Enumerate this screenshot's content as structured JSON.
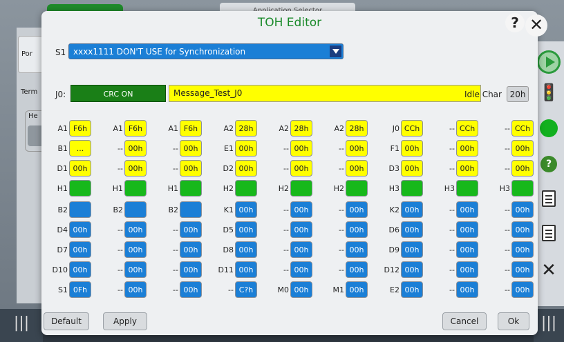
{
  "background": {
    "top_tab": "Application Selector",
    "port_label": "Por",
    "term_label": "Term",
    "he_label": "He"
  },
  "dialog": {
    "title": "TOH Editor",
    "help_glyph": "?",
    "close_glyph": "✕",
    "s1": {
      "label": "S1",
      "value": "xxxx1111 DON'T USE for Synchronization"
    },
    "j0": {
      "label": "J0:",
      "crc_button": "CRC ON",
      "message": "Message_Test_J0"
    },
    "idle": {
      "label": "Idle Char",
      "value": "20h"
    },
    "grid": [
      [
        {
          "l": "A1",
          "v": "F6h",
          "c": "yellow"
        },
        {
          "l": "A1",
          "v": "F6h",
          "c": "yellow"
        },
        {
          "l": "A1",
          "v": "F6h",
          "c": "yellow"
        },
        {
          "l": "A2",
          "v": "28h",
          "c": "yellow"
        },
        {
          "l": "A2",
          "v": "28h",
          "c": "yellow"
        },
        {
          "l": "A2",
          "v": "28h",
          "c": "yellow"
        },
        {
          "l": "J0",
          "v": "CCh",
          "c": "yellow"
        },
        {
          "l": "--",
          "v": "CCh",
          "c": "yellow"
        },
        {
          "l": "--",
          "v": "CCh",
          "c": "yellow"
        }
      ],
      [
        {
          "l": "B1",
          "v": "...",
          "c": "yellow"
        },
        {
          "l": "--",
          "v": "00h",
          "c": "yellow"
        },
        {
          "l": "--",
          "v": "00h",
          "c": "yellow"
        },
        {
          "l": "E1",
          "v": "00h",
          "c": "yellow"
        },
        {
          "l": "--",
          "v": "00h",
          "c": "yellow"
        },
        {
          "l": "--",
          "v": "00h",
          "c": "yellow"
        },
        {
          "l": "F1",
          "v": "00h",
          "c": "yellow"
        },
        {
          "l": "--",
          "v": "00h",
          "c": "yellow"
        },
        {
          "l": "--",
          "v": "00h",
          "c": "yellow"
        }
      ],
      [
        {
          "l": "D1",
          "v": "00h",
          "c": "yellow"
        },
        {
          "l": "--",
          "v": "00h",
          "c": "yellow"
        },
        {
          "l": "--",
          "v": "00h",
          "c": "yellow"
        },
        {
          "l": "D2",
          "v": "00h",
          "c": "yellow"
        },
        {
          "l": "--",
          "v": "00h",
          "c": "yellow"
        },
        {
          "l": "--",
          "v": "00h",
          "c": "yellow"
        },
        {
          "l": "D3",
          "v": "00h",
          "c": "yellow"
        },
        {
          "l": "--",
          "v": "00h",
          "c": "yellow"
        },
        {
          "l": "--",
          "v": "00h",
          "c": "yellow"
        }
      ],
      [
        {
          "l": "H1",
          "v": "",
          "c": "green"
        },
        {
          "l": "H1",
          "v": "",
          "c": "green"
        },
        {
          "l": "H1",
          "v": "",
          "c": "green"
        },
        {
          "l": "H2",
          "v": "",
          "c": "green"
        },
        {
          "l": "H2",
          "v": "",
          "c": "green"
        },
        {
          "l": "H2",
          "v": "",
          "c": "green"
        },
        {
          "l": "H3",
          "v": "",
          "c": "green"
        },
        {
          "l": "H3",
          "v": "",
          "c": "green"
        },
        {
          "l": "H3",
          "v": "",
          "c": "green"
        }
      ],
      [
        {
          "l": "B2",
          "v": "",
          "c": "blue"
        },
        {
          "l": "B2",
          "v": "",
          "c": "blue"
        },
        {
          "l": "B2",
          "v": "",
          "c": "blue"
        },
        {
          "l": "K1",
          "v": "00h",
          "c": "blue"
        },
        {
          "l": "--",
          "v": "00h",
          "c": "blue"
        },
        {
          "l": "--",
          "v": "00h",
          "c": "blue"
        },
        {
          "l": "K2",
          "v": "00h",
          "c": "blue"
        },
        {
          "l": "--",
          "v": "00h",
          "c": "blue"
        },
        {
          "l": "--",
          "v": "00h",
          "c": "blue"
        }
      ],
      [
        {
          "l": "D4",
          "v": "00h",
          "c": "blue"
        },
        {
          "l": "--",
          "v": "00h",
          "c": "blue"
        },
        {
          "l": "--",
          "v": "00h",
          "c": "blue"
        },
        {
          "l": "D5",
          "v": "00h",
          "c": "blue"
        },
        {
          "l": "--",
          "v": "00h",
          "c": "blue"
        },
        {
          "l": "--",
          "v": "00h",
          "c": "blue"
        },
        {
          "l": "D6",
          "v": "00h",
          "c": "blue"
        },
        {
          "l": "--",
          "v": "00h",
          "c": "blue"
        },
        {
          "l": "--",
          "v": "00h",
          "c": "blue"
        }
      ],
      [
        {
          "l": "D7",
          "v": "00h",
          "c": "blue"
        },
        {
          "l": "--",
          "v": "00h",
          "c": "blue"
        },
        {
          "l": "--",
          "v": "00h",
          "c": "blue"
        },
        {
          "l": "D8",
          "v": "00h",
          "c": "blue"
        },
        {
          "l": "--",
          "v": "00h",
          "c": "blue"
        },
        {
          "l": "--",
          "v": "00h",
          "c": "blue"
        },
        {
          "l": "D9",
          "v": "00h",
          "c": "blue"
        },
        {
          "l": "--",
          "v": "00h",
          "c": "blue"
        },
        {
          "l": "--",
          "v": "00h",
          "c": "blue"
        }
      ],
      [
        {
          "l": "D10",
          "v": "00h",
          "c": "blue"
        },
        {
          "l": "--",
          "v": "00h",
          "c": "blue"
        },
        {
          "l": "--",
          "v": "00h",
          "c": "blue"
        },
        {
          "l": "D11",
          "v": "00h",
          "c": "blue"
        },
        {
          "l": "--",
          "v": "00h",
          "c": "blue"
        },
        {
          "l": "--",
          "v": "00h",
          "c": "blue"
        },
        {
          "l": "D12",
          "v": "00h",
          "c": "blue"
        },
        {
          "l": "--",
          "v": "00h",
          "c": "blue"
        },
        {
          "l": "--",
          "v": "00h",
          "c": "blue"
        }
      ],
      [
        {
          "l": "S1",
          "v": "0Fh",
          "c": "blue"
        },
        {
          "l": "--",
          "v": "00h",
          "c": "blue"
        },
        {
          "l": "--",
          "v": "00h",
          "c": "blue"
        },
        {
          "l": "--",
          "v": "C?h",
          "c": "blue"
        },
        {
          "l": "M0",
          "v": "00h",
          "c": "blue"
        },
        {
          "l": "M1",
          "v": "00h",
          "c": "blue"
        },
        {
          "l": "E2",
          "v": "00h",
          "c": "blue"
        },
        {
          "l": "--",
          "v": "00h",
          "c": "blue"
        },
        {
          "l": "--",
          "v": "00h",
          "c": "blue"
        }
      ]
    ],
    "footer": {
      "default": "Default",
      "apply": "Apply",
      "cancel": "Cancel",
      "ok": "Ok"
    }
  },
  "rail": {
    "help_glyph": "?",
    "close_glyph": "✕",
    "grip": "|||"
  },
  "colors": {
    "yellow": "#ffff00",
    "blue": "#1b7fd6",
    "green": "#17b81b",
    "title": "#1a8a2a"
  }
}
